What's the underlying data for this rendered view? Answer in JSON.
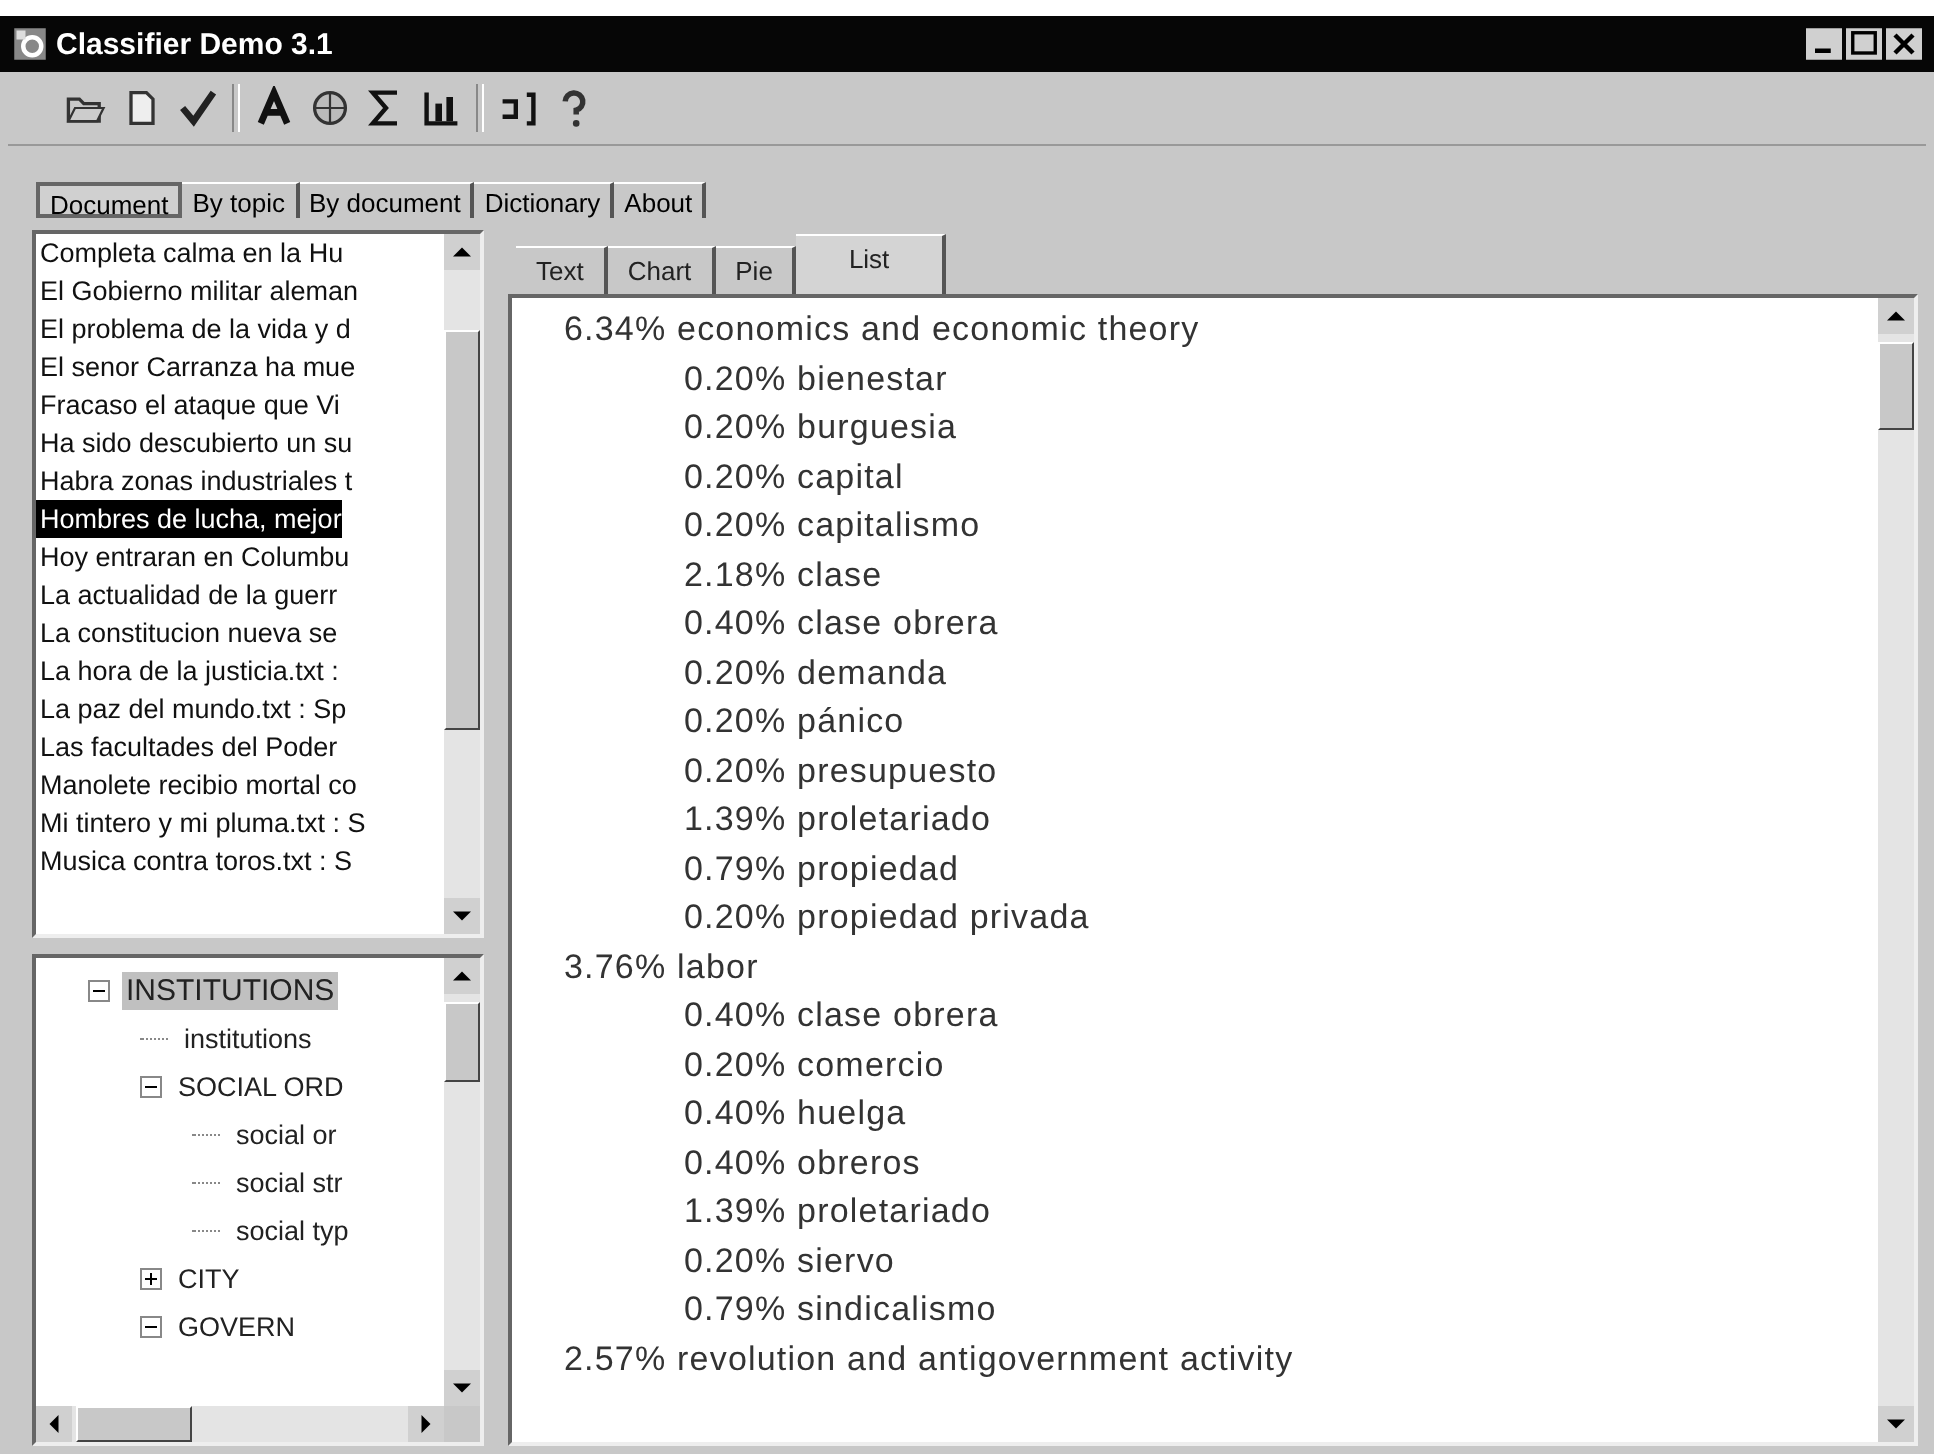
{
  "window": {
    "title": "Classifier Demo 3.1"
  },
  "tabs": [
    {
      "label": "Document",
      "selected": true
    },
    {
      "label": "By topic",
      "selected": false
    },
    {
      "label": "By document",
      "selected": false
    },
    {
      "label": "Dictionary",
      "selected": false
    },
    {
      "label": "About",
      "selected": false
    }
  ],
  "documents": [
    {
      "label": "Completa calma en la Hu",
      "selected": false
    },
    {
      "label": "El Gobierno militar aleman",
      "selected": false
    },
    {
      "label": "El problema de la vida y d",
      "selected": false
    },
    {
      "label": "El senor Carranza ha mue",
      "selected": false
    },
    {
      "label": "Fracaso el ataque que Vi",
      "selected": false
    },
    {
      "label": "Ha sido descubierto un su",
      "selected": false
    },
    {
      "label": "Habra zonas industriales t",
      "selected": false
    },
    {
      "label": "Hombres de lucha, mejor",
      "selected": true
    },
    {
      "label": "Hoy entraran en Columbu",
      "selected": false
    },
    {
      "label": "La actualidad de la guerr",
      "selected": false
    },
    {
      "label": "La constitucion nueva se",
      "selected": false
    },
    {
      "label": "La hora de la justicia.txt :",
      "selected": false
    },
    {
      "label": "La paz del mundo.txt : Sp",
      "selected": false
    },
    {
      "label": "Las facultades del Poder",
      "selected": false
    },
    {
      "label": "Manolete recibio mortal co",
      "selected": false
    },
    {
      "label": "Mi tintero y mi pluma.txt : S",
      "selected": false
    },
    {
      "label": "Musica contra toros.txt : S",
      "selected": false
    }
  ],
  "tree": [
    {
      "label": "INSTITUTIONS",
      "expanded": true,
      "selected": true,
      "children": [
        {
          "label": "institutions",
          "selected": false
        },
        {
          "label": "SOCIAL ORD",
          "expanded": true,
          "selected": false,
          "children": [
            {
              "label": "social or",
              "selected": false
            },
            {
              "label": "social str",
              "selected": false
            },
            {
              "label": "social typ",
              "selected": false
            }
          ]
        },
        {
          "label": "CITY",
          "expanded": false,
          "selected": false
        },
        {
          "label": "GOVERN",
          "expanded": true,
          "selected": false
        }
      ]
    }
  ],
  "view_tabs": [
    {
      "label": "Text",
      "selected": false
    },
    {
      "label": "Chart",
      "selected": false
    },
    {
      "label": "Pie",
      "selected": false
    },
    {
      "label": "List",
      "selected": true
    }
  ],
  "topic_list": [
    {
      "kind": "topic",
      "share": "6.34%",
      "label": "economics and economic theory"
    },
    {
      "kind": "term",
      "share": "0.20%",
      "label": "bienestar"
    },
    {
      "kind": "term",
      "share": "0.20%",
      "label": "burguesia"
    },
    {
      "kind": "term",
      "share": "0.20%",
      "label": "capital"
    },
    {
      "kind": "term",
      "share": "0.20%",
      "label": "capitalismo"
    },
    {
      "kind": "term",
      "share": "2.18%",
      "label": "clase"
    },
    {
      "kind": "term",
      "share": "0.40%",
      "label": "clase obrera"
    },
    {
      "kind": "term",
      "share": "0.20%",
      "label": "demanda"
    },
    {
      "kind": "term",
      "share": "0.20%",
      "label": "pánico"
    },
    {
      "kind": "term",
      "share": "0.20%",
      "label": "presupuesto"
    },
    {
      "kind": "term",
      "share": "1.39%",
      "label": "proletariado"
    },
    {
      "kind": "term",
      "share": "0.79%",
      "label": "propiedad"
    },
    {
      "kind": "term",
      "share": "0.20%",
      "label": "propiedad privada"
    },
    {
      "kind": "topic",
      "share": "3.76%",
      "label": "labor"
    },
    {
      "kind": "term",
      "share": "0.40%",
      "label": "clase obrera"
    },
    {
      "kind": "term",
      "share": "0.20%",
      "label": "comercio"
    },
    {
      "kind": "term",
      "share": "0.40%",
      "label": "huelga"
    },
    {
      "kind": "term",
      "share": "0.40%",
      "label": "obreros"
    },
    {
      "kind": "term",
      "share": "1.39%",
      "label": "proletariado"
    },
    {
      "kind": "term",
      "share": "0.20%",
      "label": "siervo"
    },
    {
      "kind": "term",
      "share": "0.79%",
      "label": "sindicalismo"
    },
    {
      "kind": "topic",
      "share": "2.57%",
      "label": "revolution and antigovernment activity"
    }
  ]
}
